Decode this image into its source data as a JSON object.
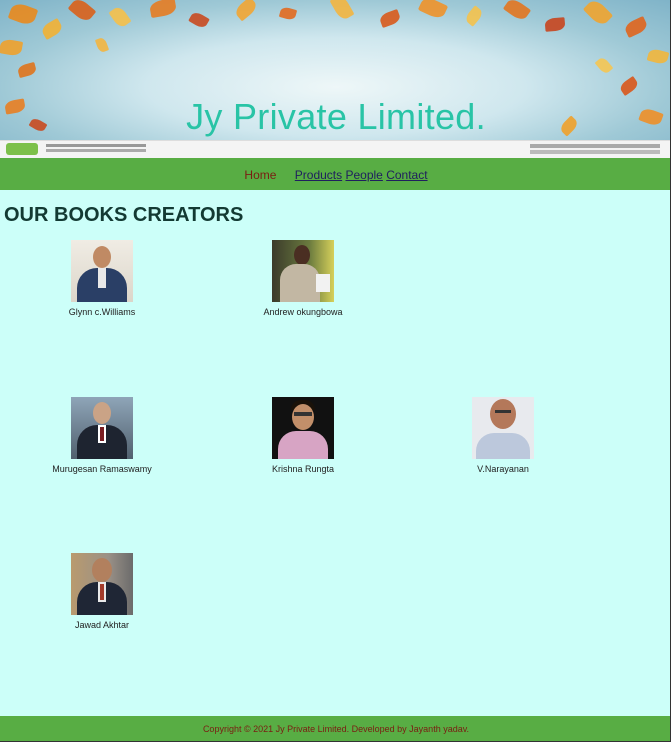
{
  "banner": {
    "title": "Jy Private Limited."
  },
  "nav": {
    "home": "Home",
    "products": "Products",
    "people": "People",
    "contact": "Contact"
  },
  "main": {
    "heading": "OUR BOOKS CREATORS",
    "people": [
      {
        "name": "Glynn c.Williams"
      },
      {
        "name": "Andrew okungbowa"
      },
      {
        "name": "Murugesan Ramaswamy"
      },
      {
        "name": "Krishna Rungta"
      },
      {
        "name": "V.Narayanan"
      },
      {
        "name": "Jawad Akhtar"
      }
    ]
  },
  "footer": {
    "text": "Copyright © 2021 Jy Private Limited. Developed by Jayanth yadav."
  },
  "colors": {
    "nav_bg": "#58ad44",
    "main_bg": "#ccfff9",
    "title": "#29c4a6"
  }
}
